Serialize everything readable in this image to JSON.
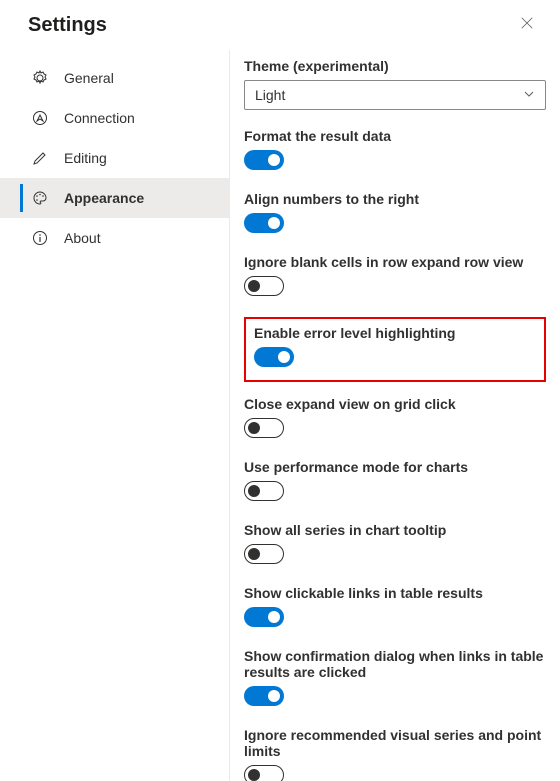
{
  "title": "Settings",
  "sidebar": {
    "items": [
      {
        "label": "General",
        "icon": "gear-icon"
      },
      {
        "label": "Connection",
        "icon": "compass-icon"
      },
      {
        "label": "Editing",
        "icon": "pencil-icon"
      },
      {
        "label": "Appearance",
        "icon": "palette-icon",
        "selected": true
      },
      {
        "label": "About",
        "icon": "info-icon"
      }
    ]
  },
  "appearance": {
    "theme": {
      "label": "Theme (experimental)",
      "value": "Light"
    },
    "settings": [
      {
        "label": "Format the result data",
        "on": true
      },
      {
        "label": "Align numbers to the right",
        "on": true
      },
      {
        "label": "Ignore blank cells in row expand row view",
        "on": false
      },
      {
        "label": "Enable error level highlighting",
        "on": true,
        "highlighted": true
      },
      {
        "label": "Close expand view on grid click",
        "on": false
      },
      {
        "label": "Use performance mode for charts",
        "on": false
      },
      {
        "label": "Show all series in chart tooltip",
        "on": false
      },
      {
        "label": "Show clickable links in table results",
        "on": true
      },
      {
        "label": "Show confirmation dialog when links in table results are clicked",
        "on": true
      },
      {
        "label": "Ignore recommended visual series and point limits",
        "on": false
      }
    ]
  },
  "colors": {
    "accent": "#0078d4",
    "highlight_border": "#e60000"
  }
}
